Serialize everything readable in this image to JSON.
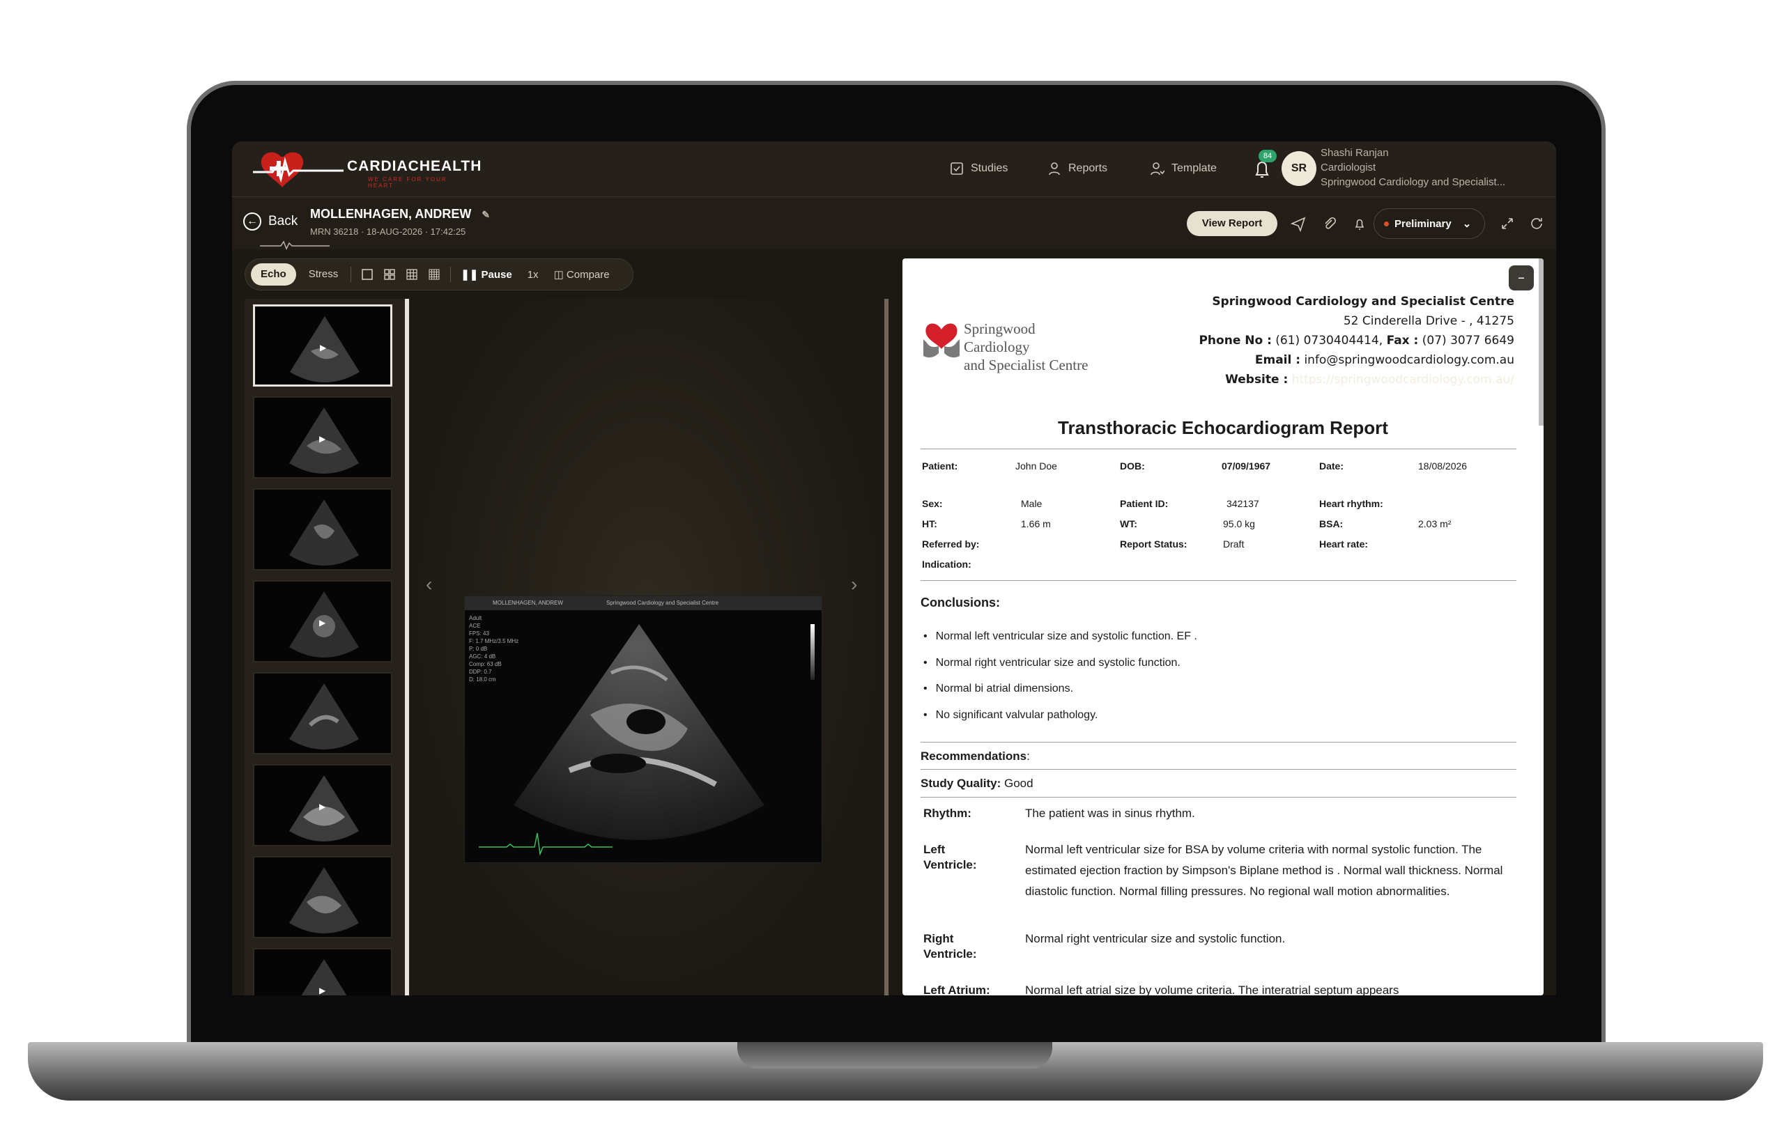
{
  "app": {
    "brand": "CARDIACHEALTH",
    "tagline": "WE CARE FOR YOUR HEART"
  },
  "nav": {
    "studies": "Studies",
    "reports": "Reports",
    "template": "Template",
    "notifications_count": "84"
  },
  "user": {
    "initials": "SR",
    "name": "Shashi Ranjan",
    "role": "Cardiologist",
    "org": "Springwood Cardiology and Specialist..."
  },
  "patient": {
    "back_label": "Back",
    "name": "MOLLENHAGEN, ANDREW",
    "meta": "MRN 36218 · 18-AUG-2026 · 17:42:25"
  },
  "actions": {
    "view_report": "View Report",
    "status": "Preliminary"
  },
  "viewer": {
    "mode_echo": "Echo",
    "mode_stress": "Stress",
    "pause": "Pause",
    "speed": "1x",
    "compare": "Compare",
    "image_header_name": "MOLLENHAGEN, ANDREW",
    "image_header_site": "Springwood Cardiology and Specialist Centre",
    "image_info": [
      "Adult",
      "ACE",
      "FPS: 43",
      "F: 1.7 MHz/3.5 MHz",
      "P: 0 dB",
      "AGC: 4 dB",
      "Comp: 63 dB",
      "DDP: 0.7",
      "D: 18.0 cm"
    ],
    "prev_arrow": "‹",
    "next_arrow": "›"
  },
  "report": {
    "clinic_logo_line1": "Springwood Cardiology",
    "clinic_logo_line2": "and Specialist Centre",
    "clinic_name": "Springwood Cardiology and Specialist Centre",
    "address": "52 Cinderella Drive - , 41275",
    "phone_label": "Phone No :",
    "phone": "(61) 0730404414,",
    "fax_label": "Fax :",
    "fax": "(07) 3077 6649",
    "email_label": "Email :",
    "email": "info@springwoodcardiology.com.au",
    "website_label": "Website :",
    "website": "https://springwoodcardiology.com.au/",
    "title": "Transthoracic Echocardiogram Report",
    "fields": {
      "patient_label": "Patient:",
      "patient": "John Doe",
      "dob_label": "DOB:",
      "dob": "07/09/1967",
      "date_label": "Date:",
      "date": "18/08/2026",
      "sex_label": "Sex:",
      "sex": "Male",
      "pid_label": "Patient ID:",
      "pid": "342137",
      "rhythm_label": "Heart rhythm:",
      "ht_label": "HT:",
      "ht": "1.66 m",
      "wt_label": "WT:",
      "wt": "95.0 kg",
      "bsa_label": "BSA:",
      "bsa": "2.03 m²",
      "referred_label": "Referred by:",
      "status_label": "Report Status:",
      "status": "Draft",
      "hr_label": "Heart rate:",
      "indication_label": "Indication:"
    },
    "conclusions_title": "Conclusions:",
    "conclusions": [
      "Normal left ventricular size and systolic function. EF .",
      "Normal right ventricular size and systolic function.",
      "Normal bi atrial dimensions.",
      "No significant valvular pathology."
    ],
    "recommendations_label": "Recommendations",
    "recommendations_colon": ":",
    "quality_label": "Study Quality:",
    "quality": "Good",
    "details": [
      {
        "label": "Rhythm:",
        "text": "The patient was in sinus rhythm."
      },
      {
        "label": "Left Ventricle:",
        "text": "Normal left ventricular size for BSA by volume criteria with normal systolic function. The estimated ejection fraction by Simpson's Biplane method is . Normal wall thickness. Normal diastolic function. Normal filling pressures. No regional wall motion abnormalities."
      },
      {
        "label": "Right Ventricle:",
        "text": "Normal right ventricular size and systolic function."
      },
      {
        "label": "Left Atrium:",
        "text": "Normal left atrial size by volume criteria. The interatrial septum appears"
      }
    ]
  }
}
